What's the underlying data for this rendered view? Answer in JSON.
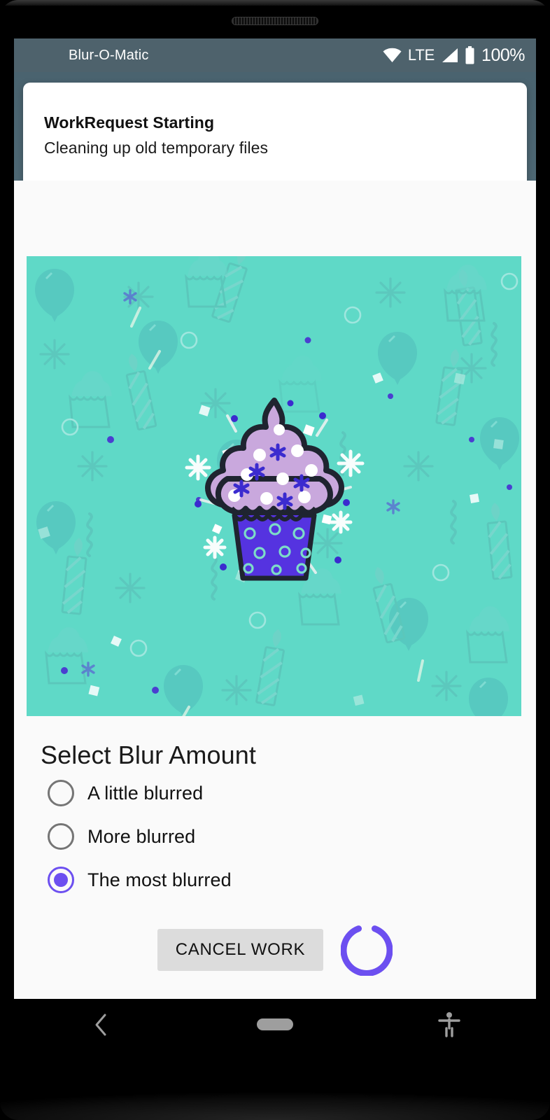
{
  "device": {
    "speaker_grille": "speaker-grille"
  },
  "status_bar": {
    "app_title": "Blur-O-Matic",
    "wifi_icon": "wifi-icon",
    "network_label": "LTE",
    "signal_icon": "signal-bars-icon",
    "battery_icon": "battery-icon",
    "battery_percent": "100%",
    "background_color": "#4e626c"
  },
  "app_bar": {
    "background_color": "#47606d"
  },
  "toast": {
    "title": "WorkRequest Starting",
    "message": "Cleaning up old temporary files",
    "background_color": "#ffffff"
  },
  "image": {
    "name": "cupcake-image",
    "background_color": "#5fd9c7",
    "frosting_color": "#c9a8dd",
    "liner_color": "#5533e0",
    "outline_color": "#1f2430"
  },
  "blur": {
    "title": "Select Blur Amount",
    "options": [
      {
        "label": "A little blurred",
        "selected": false
      },
      {
        "label": "More blurred",
        "selected": false
      },
      {
        "label": "The most blurred",
        "selected": true
      }
    ],
    "selected_color": "#6c4ff0",
    "unselected_color": "#757575"
  },
  "actions": {
    "cancel_label": "CANCEL WORK",
    "cancel_background": "#dcdcdc",
    "spinner_name": "progress-spinner",
    "spinner_color": "#6c4ff0"
  },
  "nav_bar": {
    "back_icon": "back-chevron-icon",
    "home_icon": "home-pill-icon",
    "accessibility_icon": "accessibility-icon",
    "background_color": "#000000"
  }
}
